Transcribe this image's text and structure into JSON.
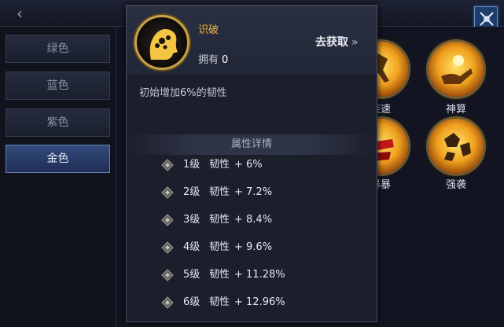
{
  "window": {
    "back_icon": "chevron-left-icon",
    "close_icon": "close-x-icon"
  },
  "sidebar": {
    "tabs": [
      {
        "label": "绿色",
        "active": false
      },
      {
        "label": "蓝色",
        "active": false
      },
      {
        "label": "紫色",
        "active": false
      },
      {
        "label": "金色",
        "active": true
      }
    ]
  },
  "skills": [
    {
      "label": "疾速",
      "icon": "running-figure-icon"
    },
    {
      "label": "神算",
      "icon": "hand-with-orb-icon"
    },
    {
      "label": "暴暴",
      "icon": "red-slash-icon"
    },
    {
      "label": "强袭",
      "icon": "exploding-rock-icon"
    }
  ],
  "detail": {
    "name": "识破",
    "owned_label": "拥有",
    "owned_count": "0",
    "acquire_label": "去获取",
    "description": "初始增加6%的韧性",
    "section_title": "属性详情",
    "levels": [
      {
        "level": "1级",
        "attr": "韧性",
        "value": "+ 6%"
      },
      {
        "level": "2级",
        "attr": "韧性",
        "value": "+ 7.2%"
      },
      {
        "level": "3级",
        "attr": "韧性",
        "value": "+ 8.4%"
      },
      {
        "level": "4级",
        "attr": "韧性",
        "value": "+ 9.6%"
      },
      {
        "level": "5级",
        "attr": "韧性",
        "value": "+ 11.28%"
      },
      {
        "level": "6级",
        "attr": "韧性",
        "value": "+ 12.96%"
      }
    ]
  },
  "colors": {
    "gold_text": "#f2b33c",
    "active_tab": "#324a7c",
    "panel_bg": "#1b1e2b"
  }
}
